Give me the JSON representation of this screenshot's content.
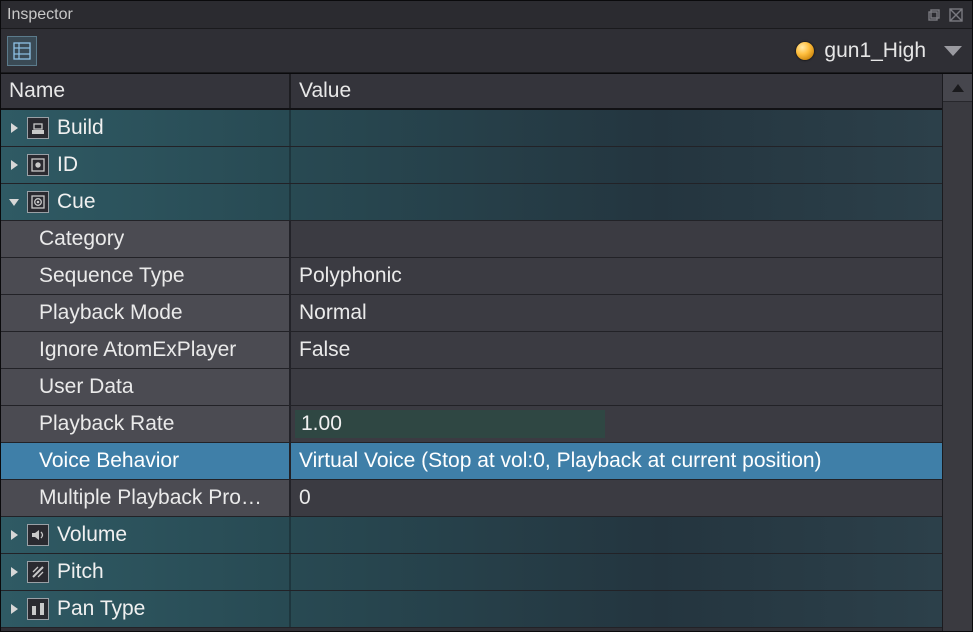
{
  "panel": {
    "title": "Inspector"
  },
  "object": {
    "name": "gun1_High"
  },
  "grid": {
    "headers": {
      "name": "Name",
      "value": "Value"
    },
    "rows": [
      {
        "kind": "header",
        "icon": "build-icon",
        "label": "Build",
        "expanded": false
      },
      {
        "kind": "header",
        "icon": "id-icon",
        "label": "ID",
        "expanded": false
      },
      {
        "kind": "header",
        "icon": "cue-icon",
        "label": "Cue",
        "expanded": true
      },
      {
        "kind": "prop",
        "label": "Category",
        "value": ""
      },
      {
        "kind": "prop",
        "label": "Sequence Type",
        "value": "Polyphonic"
      },
      {
        "kind": "prop",
        "label": "Playback Mode",
        "value": "Normal"
      },
      {
        "kind": "prop",
        "label": "Ignore AtomExPlayer",
        "value": "False"
      },
      {
        "kind": "prop",
        "label": "User Data",
        "value": ""
      },
      {
        "kind": "prop",
        "label": "Playback Rate",
        "value": "1.00",
        "editable": true
      },
      {
        "kind": "prop",
        "label": "Voice Behavior",
        "value": "Virtual Voice (Stop at vol:0, Playback at current position)",
        "selected": true
      },
      {
        "kind": "prop",
        "label": "Multiple Playback Pro…",
        "value": "0"
      },
      {
        "kind": "header",
        "icon": "volume-icon",
        "label": "Volume",
        "expanded": false
      },
      {
        "kind": "header",
        "icon": "pitch-icon",
        "label": "Pitch",
        "expanded": false
      },
      {
        "kind": "header",
        "icon": "pantype-icon",
        "label": "Pan Type",
        "expanded": false
      }
    ]
  }
}
